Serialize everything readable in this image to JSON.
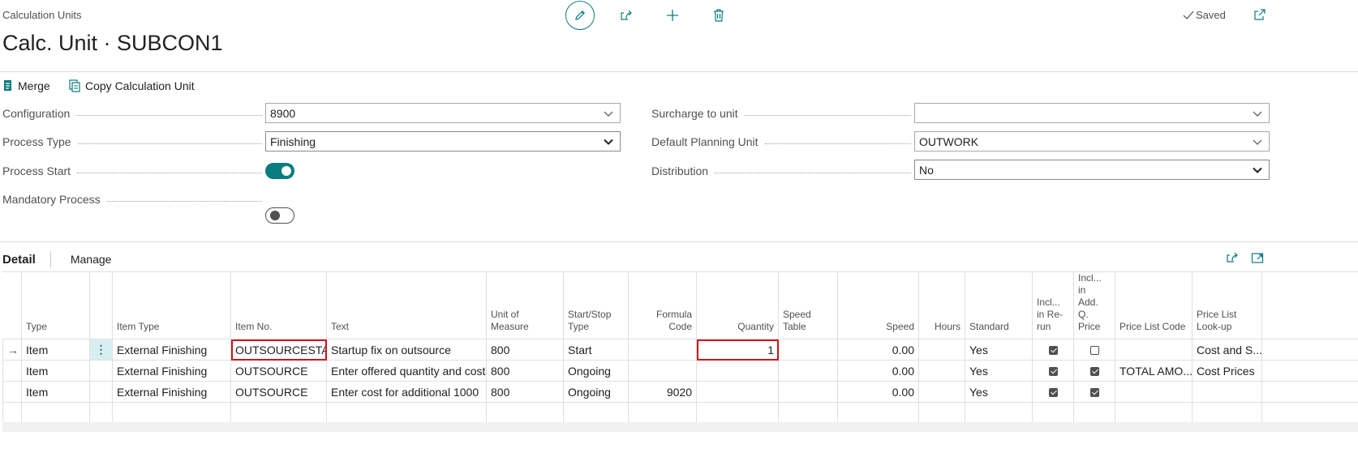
{
  "header": {
    "breadcrumb": "Calculation Units",
    "title": "Calc. Unit · SUBCON1",
    "saved_label": "Saved"
  },
  "actions": {
    "merge": "Merge",
    "copy": "Copy Calculation Unit"
  },
  "fields": {
    "configuration": {
      "label": "Configuration",
      "value": "8900"
    },
    "process_type": {
      "label": "Process Type",
      "value": "Finishing"
    },
    "process_start": {
      "label": "Process Start",
      "on": true
    },
    "mandatory_process": {
      "label": "Mandatory Process",
      "on": false
    },
    "surcharge_to_unit": {
      "label": "Surcharge to unit",
      "value": ""
    },
    "default_planning_unit": {
      "label": "Default Planning Unit",
      "value": "OUTWORK"
    },
    "distribution": {
      "label": "Distribution",
      "value": "No"
    }
  },
  "tabs": {
    "detail": "Detail",
    "manage": "Manage"
  },
  "table": {
    "headers": {
      "type": "Type",
      "item_type": "Item Type",
      "item_no": "Item No.",
      "text": "Text",
      "uom_1": "Unit of",
      "uom_2": "Measure",
      "start_stop_1": "Start/Stop",
      "start_stop_2": "Type",
      "formula_1": "Formula",
      "formula_2": "Code",
      "quantity": "Quantity",
      "speed_table_1": "Speed",
      "speed_table_2": "Table",
      "speed": "Speed",
      "hours": "Hours",
      "standard": "Standard",
      "incl_rerun_1": "Incl...",
      "incl_rerun_2": "in Re-",
      "incl_rerun_3": "run",
      "incl_add_1": "Incl...",
      "incl_add_2": "in",
      "incl_add_3": "Add.",
      "incl_add_4": "Q.",
      "incl_add_5": "Price",
      "price_list_code": "Price List Code",
      "price_list_lookup_1": "Price List",
      "price_list_lookup_2": "Look-up"
    },
    "rows": [
      {
        "type": "Item",
        "item_type": "External Finishing",
        "item_no": "OUTSOURCESTART",
        "text": "Startup fix on outsource",
        "uom": "800",
        "start_stop": "Start",
        "formula": "",
        "quantity": "1",
        "speed_table": "",
        "speed": "0.00",
        "hours": "",
        "standard": "Yes",
        "incl_rerun": true,
        "incl_add": false,
        "price_list_code": "",
        "lookup": "Cost and S..."
      },
      {
        "type": "Item",
        "item_type": "External Finishing",
        "item_no": "OUTSOURCE",
        "text": "Enter offered quantity and cost",
        "uom": "800",
        "start_stop": "Ongoing",
        "formula": "",
        "quantity": "",
        "speed_table": "",
        "speed": "0.00",
        "hours": "",
        "standard": "Yes",
        "incl_rerun": true,
        "incl_add": true,
        "price_list_code": "TOTAL AMO...",
        "lookup": "Cost Prices"
      },
      {
        "type": "Item",
        "item_type": "External Finishing",
        "item_no": "OUTSOURCE",
        "text": "Enter cost for additional 1000",
        "uom": "800",
        "start_stop": "Ongoing",
        "formula": "9020",
        "quantity": "",
        "speed_table": "",
        "speed": "0.00",
        "hours": "",
        "standard": "Yes",
        "incl_rerun": true,
        "incl_add": true,
        "price_list_code": "",
        "lookup": ""
      }
    ]
  },
  "colors": {
    "accent": "#0a7c7f",
    "highlight": "#d0121b"
  }
}
